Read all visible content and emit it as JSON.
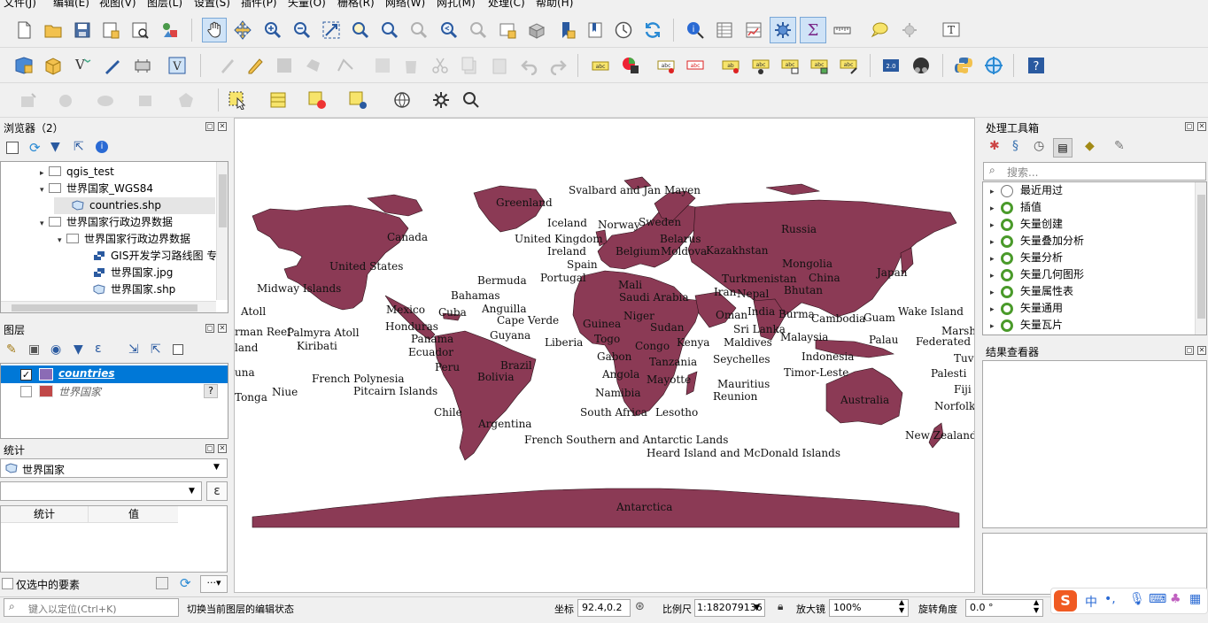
{
  "menu": [
    "文件(J)",
    "编辑(E)",
    "视图(V)",
    "图层(L)",
    "设置(S)",
    "插件(P)",
    "矢量(O)",
    "栅格(R)",
    "网络(W)",
    "网孔(M)",
    "处理(C)",
    "帮助(H)"
  ],
  "browser": {
    "title": "浏览器（2）",
    "items": [
      "qgis_test",
      "世界国家_WGS84",
      "countries.shp",
      "世界国家行政边界数据",
      "世界国家行政边界数据",
      "GIS开发学习路线图 专",
      "世界国家.jpg",
      "世界国家.shp"
    ]
  },
  "layers": {
    "title": "图层",
    "items": [
      {
        "name": "countries",
        "checked": true,
        "color": "#8b3a55"
      },
      {
        "name": "世界国家",
        "checked": false,
        "color": "#c04848"
      }
    ]
  },
  "stats": {
    "title": "统计",
    "layer": "世界国家",
    "col_stat": "统计",
    "col_value": "值",
    "selected_only": "仅选中的要素",
    "expr_icon": "ε"
  },
  "toolbox": {
    "title": "处理工具箱",
    "search_placeholder": "搜索...",
    "items": [
      "最近用过",
      "插值",
      "矢量创建",
      "矢量叠加分析",
      "矢量分析",
      "矢量几何图形",
      "矢量属性表",
      "矢量通用",
      "矢量瓦片"
    ]
  },
  "results": {
    "title": "结果查看器"
  },
  "map": {
    "fill": "#8b3a55",
    "labels": [
      "Svalbard and Jan Mayen",
      "Greenland",
      "Iceland",
      "Norway",
      "Sweden",
      "Russia",
      "Canada",
      "United Kingdom",
      "Belarus",
      "Ireland",
      "Belgium",
      "Moldova",
      "Kazakhstan",
      "Mongolia",
      "United States",
      "Spain",
      "Portugal",
      "Japan",
      "Bermuda",
      "Mali",
      "Turkmenistan",
      "China",
      "Midway Islands",
      "Bahamas",
      "Saudi Arabia",
      "Iran",
      "Nepal",
      "Bhutan",
      "Atoll",
      "Mexico",
      "Cuba",
      "Anguilla",
      "Cape Verde",
      "Niger",
      "Oman",
      "India",
      "Burma",
      "Guam",
      "Wake Island",
      "Honduras",
      "Guyana",
      "Guinea",
      "Sudan",
      "Sri Lanka",
      "Cambodia",
      "Marsha",
      "Kiribati",
      "Palmyra Atoll",
      "Panama",
      "Liberia",
      "Togo",
      "Congo",
      "Kenya",
      "Maldives",
      "Malaysia",
      "Palau",
      "Federated",
      "Ecuador",
      "Gabon",
      "Seychelles",
      "Indonesia",
      "Tuva",
      "Peru",
      "Brazil",
      "Angola",
      "Tanzania",
      "Timor-Leste",
      "Palesti",
      "French Polynesia",
      "Bolivia",
      "Mauritius",
      "Fiji",
      "Niue",
      "Pitcairn Islands",
      "Namibia",
      "Mayotte",
      "Reunion",
      "Australia",
      "Tonga",
      "Chile",
      "South Africa",
      "Lesotho",
      "Norfolk",
      "Argentina",
      "French Southern and Antarctic Lands",
      "New Zealand",
      "Heard Island and McDonald Islands",
      "Antarctica",
      "rman Reef",
      "land",
      "una"
    ]
  },
  "status": {
    "search_placeholder": "键入以定位(Ctrl+K)",
    "message": "切换当前图层的编辑状态",
    "coord_label": "坐标",
    "coord_value": "92.4,0.2",
    "scale_label": "比例尺",
    "scale_value": "1:182079136",
    "magnifier_label": "放大镜",
    "magnifier_value": "100%",
    "rotation_label": "旋转角度",
    "rotation_value": "0.0 °"
  },
  "ime": {
    "logo": "S",
    "lang": "中"
  }
}
